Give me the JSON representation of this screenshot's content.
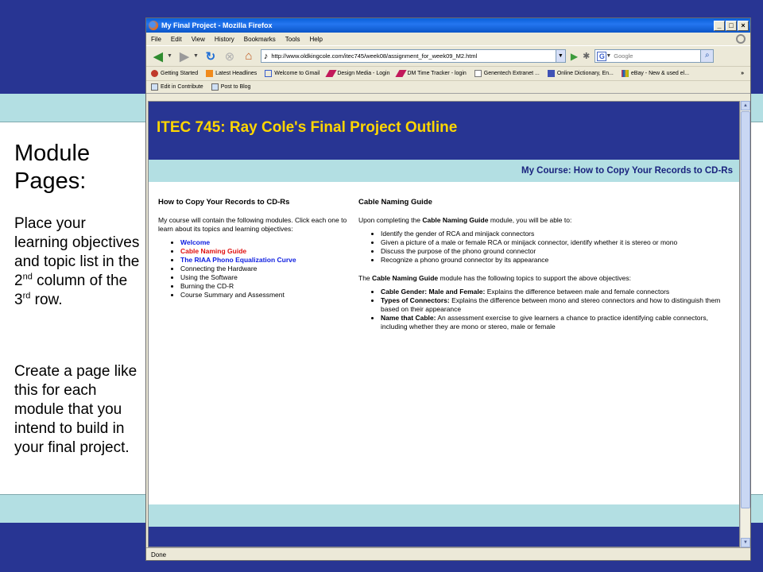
{
  "slide": {
    "title": "Module Pages:",
    "para1": {
      "before_nd": "Place your learning objectives and topic list in the 2",
      "nd": "nd",
      "between": " column of the 3",
      "rd": "rd",
      "after": " row."
    },
    "para2": "Create a page like this for each module that you intend to build in your final project."
  },
  "browser": {
    "title": "My Final Project - Mozilla Firefox",
    "menus": [
      "File",
      "Edit",
      "View",
      "History",
      "Bookmarks",
      "Tools",
      "Help"
    ],
    "url": "http://www.oldkingcole.com/itec745/week08/assignment_for_week09_M2.html",
    "search_placeholder": "Google",
    "bookmarks": [
      "Getting Started",
      "Latest Headlines",
      "Welcome to Gmail",
      "Design Media - Login",
      "DM Time Tracker - login",
      "Genentech Extranet ...",
      "Online Dictionary, En...",
      "eBay - New & used el..."
    ],
    "toolbar2": [
      "Edit in Contribute",
      "Post to Blog"
    ],
    "status": "Done"
  },
  "page": {
    "title": "ITEC 745: Ray Cole's Final Project Outline",
    "subheader": "My Course: How to Copy Your Records to CD-Rs",
    "col1": {
      "heading": "How to Copy Your Records to CD-Rs",
      "intro": "My course will contain the following modules. Click each one to learn about its topics and learning objectives:",
      "modules": [
        "Welcome",
        "Cable Naming Guide",
        "The RIAA Phono Equalization Curve",
        "Connecting the Hardware",
        "Using the Software",
        "Burning the CD-R",
        "Course Summary and Assessment"
      ]
    },
    "col2": {
      "heading": "Cable Naming Guide",
      "intro_before": "Upon completing the ",
      "intro_bold": "Cable Naming Guide",
      "intro_after": " module, you will be able to:",
      "objectives": [
        "Identify the gender of RCA and minijack connectors",
        "Given a picture of a male or female RCA or minijack connector, identify whether it is stereo or mono",
        "Discuss the purpose of the phono ground connector",
        "Recognize a phono ground connector by its appearance"
      ],
      "topics_before": "The ",
      "topics_bold": "Cable Naming Guide",
      "topics_after": " module has the following topics to support the above objectives:",
      "topics": [
        {
          "name": "Cable Gender: Male and Female:",
          "desc": " Explains the difference between male and female connectors"
        },
        {
          "name": "Types of Connectors:",
          "desc": " Explains the difference between mono and stereo connectors and how to distinguish them based on their appearance"
        },
        {
          "name": "Name that Cable:",
          "desc": " An assessment exercise to give learners a chance to practice identifying cable connectors, including whether they are mono or stereo, male or female"
        }
      ]
    }
  }
}
